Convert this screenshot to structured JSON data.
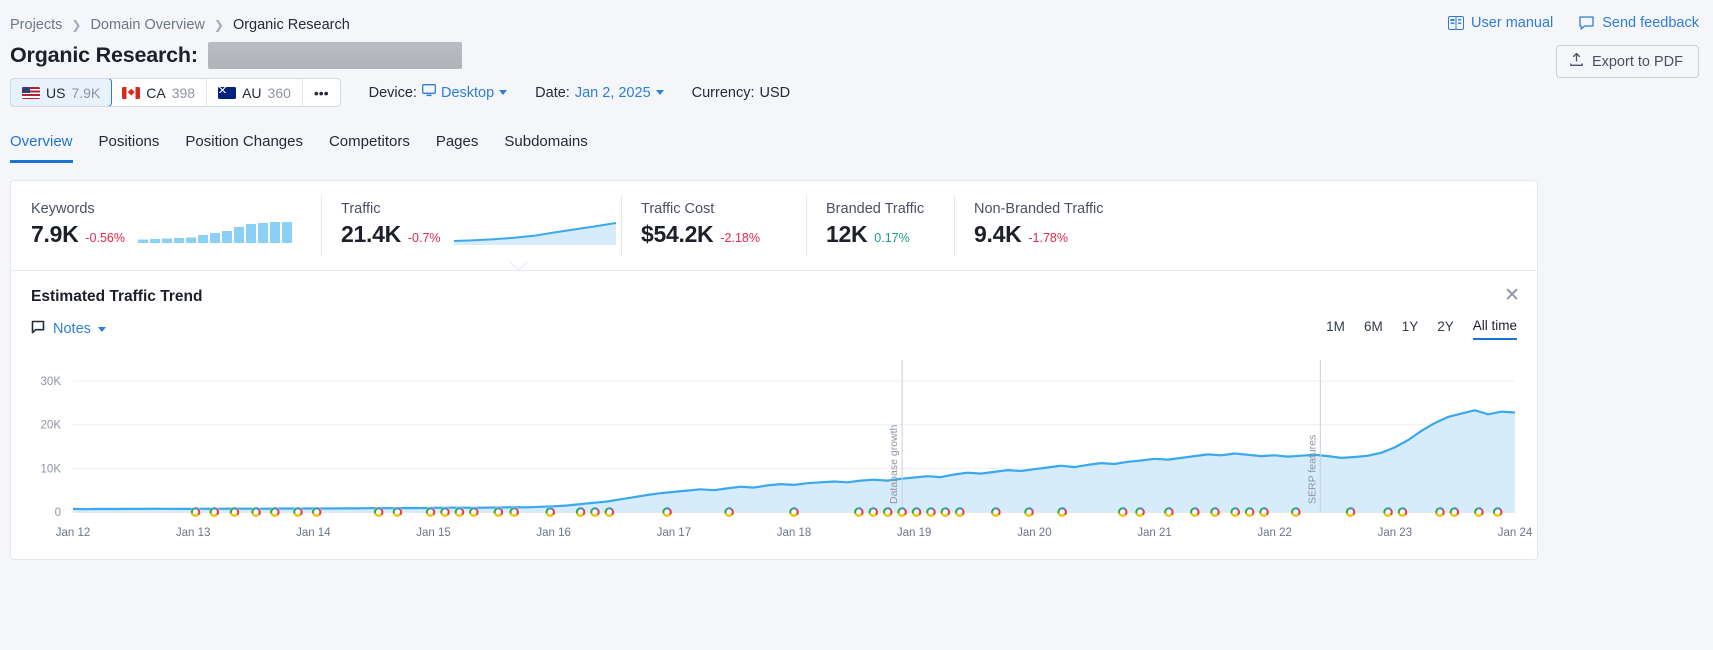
{
  "breadcrumb": [
    {
      "label": "Projects"
    },
    {
      "label": "Domain Overview"
    },
    {
      "label": "Organic Research"
    }
  ],
  "header": {
    "title_prefix": "Organic Research:",
    "domain_redacted": "",
    "user_manual": "User manual",
    "send_feedback": "Send feedback",
    "export_pdf": "Export to PDF"
  },
  "databases": [
    {
      "code": "US",
      "count": "7.9K",
      "flag": "flag-us-icon",
      "active": true
    },
    {
      "code": "CA",
      "count": "398",
      "flag": "flag-ca-icon",
      "active": false
    },
    {
      "code": "AU",
      "count": "360",
      "flag": "flag-au-icon",
      "active": false
    }
  ],
  "db_more": "•••",
  "filters": {
    "device_label": "Device:",
    "device_value": "Desktop",
    "date_label": "Date:",
    "date_value": "Jan 2, 2025",
    "currency_label": "Currency:",
    "currency_value": "USD"
  },
  "tabs": [
    {
      "label": "Overview",
      "active": true
    },
    {
      "label": "Positions",
      "active": false
    },
    {
      "label": "Position Changes",
      "active": false
    },
    {
      "label": "Competitors",
      "active": false
    },
    {
      "label": "Pages",
      "active": false
    },
    {
      "label": "Subdomains",
      "active": false
    }
  ],
  "metrics": [
    {
      "label": "Keywords",
      "value": "7.9K",
      "delta": "-0.56%",
      "delta_dir": "neg",
      "spark": "bars"
    },
    {
      "label": "Traffic",
      "value": "21.4K",
      "delta": "-0.7%",
      "delta_dir": "neg",
      "spark": "area"
    },
    {
      "label": "Traffic Cost",
      "value": "$54.2K",
      "delta": "-2.18%",
      "delta_dir": "neg",
      "spark": "none"
    },
    {
      "label": "Branded Traffic",
      "value": "12K",
      "delta": "0.17%",
      "delta_dir": "pos",
      "spark": "none"
    },
    {
      "label": "Non-Branded Traffic",
      "value": "9.4K",
      "delta": "-1.78%",
      "delta_dir": "neg",
      "spark": "none"
    }
  ],
  "chart_section": {
    "title": "Estimated Traffic Trend",
    "notes_label": "Notes",
    "close_icon": "close-icon",
    "ranges": [
      {
        "label": "1M",
        "active": false
      },
      {
        "label": "6M",
        "active": false
      },
      {
        "label": "1Y",
        "active": false
      },
      {
        "label": "2Y",
        "active": false
      },
      {
        "label": "All time",
        "active": true
      }
    ]
  },
  "chart_data": {
    "type": "area",
    "title": "Estimated Traffic Trend",
    "xlabel": "",
    "ylabel": "",
    "ylim": [
      0,
      33000
    ],
    "yticks": [
      0,
      10000,
      20000,
      30000
    ],
    "ytick_labels": [
      "0",
      "10K",
      "20K",
      "30K"
    ],
    "grid": true,
    "legend": "none",
    "line_color": "#3aa8ef",
    "fill_color": "#d6ecfb",
    "x_tick_labels": [
      "Jan 12",
      "Jan 13",
      "Jan 14",
      "Jan 15",
      "Jan 16",
      "Jan 17",
      "Jan 18",
      "Jan 19",
      "Jan 20",
      "Jan 21",
      "Jan 22",
      "Jan 23",
      "Jan 24"
    ],
    "annotations": [
      {
        "label": "Database growth",
        "x_position": 0.575
      },
      {
        "label": "SERP features",
        "x_position": 0.865
      }
    ],
    "series": [
      {
        "name": "Estimated traffic",
        "values": [
          700,
          650,
          700,
          680,
          720,
          700,
          760,
          740,
          720,
          700,
          760,
          740,
          780,
          760,
          740,
          780,
          800,
          780,
          820,
          800,
          840,
          820,
          860,
          900,
          880,
          920,
          900,
          940,
          980,
          1000,
          960,
          1000,
          1040,
          1100,
          1080,
          1200,
          1300,
          1500,
          1800,
          2100,
          2400,
          2900,
          3400,
          3900,
          4300,
          4600,
          4900,
          5200,
          5000,
          5400,
          5800,
          5600,
          6100,
          6400,
          6200,
          6600,
          6800,
          7000,
          6800,
          7200,
          7400,
          7200,
          7600,
          7900,
          8200,
          8000,
          8600,
          9000,
          8800,
          9200,
          9600,
          9400,
          9800,
          10200,
          10600,
          10300,
          10800,
          11200,
          11000,
          11500,
          11800,
          12200,
          12000,
          12400,
          12800,
          13200,
          13000,
          13400,
          13100,
          12800,
          13000,
          12700,
          12900,
          13100,
          12800,
          12400,
          12600,
          12900,
          13600,
          14800,
          16500,
          18600,
          20400,
          21800,
          22600,
          23300,
          22400,
          23000,
          22800
        ]
      }
    ],
    "google_markers_note": "Google algorithm update favicon markers along baseline"
  }
}
